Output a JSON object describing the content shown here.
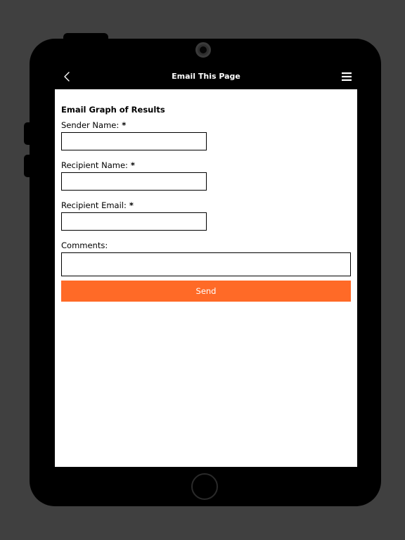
{
  "nav": {
    "title": "Email This Page",
    "back_icon": "chevron-left-icon",
    "menu_icon": "hamburger-menu-icon"
  },
  "form": {
    "title": "Email Graph of Results",
    "required_marker": "*",
    "sender_name": {
      "label": "Sender Name:",
      "value": "",
      "placeholder": ""
    },
    "recipient_name": {
      "label": "Recipient Name:",
      "value": "",
      "placeholder": ""
    },
    "recipient_email": {
      "label": "Recipient Email:",
      "value": "",
      "placeholder": ""
    },
    "comments": {
      "label": "Comments:",
      "value": "",
      "placeholder": ""
    },
    "send_label": "Send"
  },
  "colors": {
    "accent": "#ff6a27",
    "nav_background": "#000000",
    "backdrop": "#404040"
  }
}
